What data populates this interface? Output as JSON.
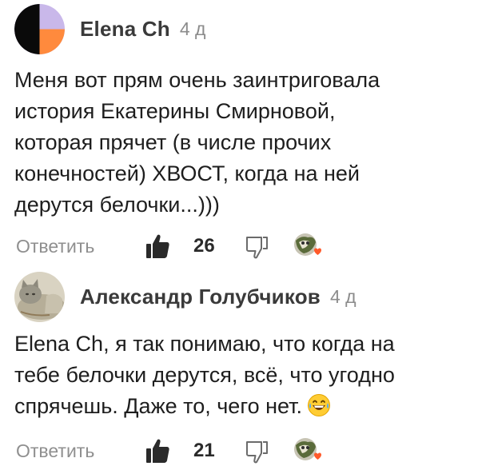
{
  "comments": [
    {
      "author": "Elena Ch",
      "time": "4 д",
      "text": "Меня вот прям очень заинтриговала\nистория Екатерины Смирновой,\nкоторая прячет  (в числе прочих\nконечностей)  ХВОСТ, когда на ней\nдерутся белочки...)))",
      "reply_label": "Ответить",
      "likes": "26"
    },
    {
      "author": "Александр Голубчиков",
      "time": "4 д",
      "text": "Elena Ch, я так понимаю, что когда на\nтебе белочки дерутся, всё, что угодно\nспрячешь. Даже то, чего нет.",
      "emoji_icon": "grinning-sweat-emoji",
      "reply_label": "Ответить",
      "likes": "21"
    }
  ],
  "colors": {
    "author": "#3a3a3a",
    "meta": "#8c8c8c",
    "text": "#1e1e1e",
    "icon": "#2a2a2a",
    "heart": "#ff5a2b"
  }
}
